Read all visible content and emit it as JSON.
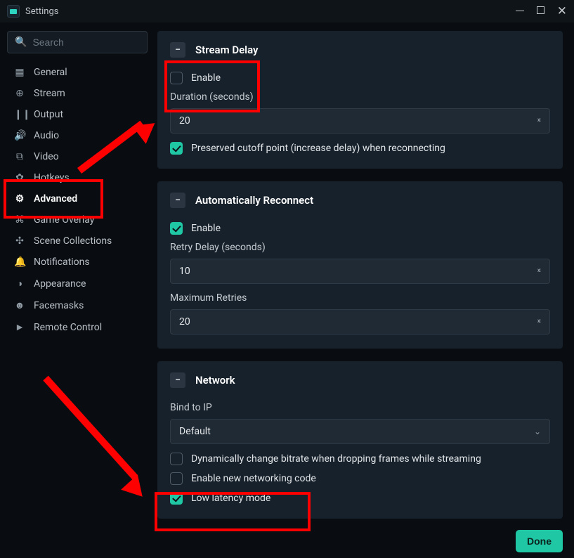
{
  "window": {
    "title": "Settings"
  },
  "search": {
    "placeholder": "Search"
  },
  "sidebar": {
    "items": [
      {
        "label": "General",
        "icon": "▦"
      },
      {
        "label": "Stream",
        "icon": "⊕"
      },
      {
        "label": "Output",
        "icon": "❙❙"
      },
      {
        "label": "Audio",
        "icon": "🔊"
      },
      {
        "label": "Video",
        "icon": "⧉"
      },
      {
        "label": "Hotkeys",
        "icon": "✿"
      },
      {
        "label": "Advanced",
        "icon": "⚙",
        "active": true
      },
      {
        "label": "Game Overlay",
        "icon": "⌘"
      },
      {
        "label": "Scene Collections",
        "icon": "✣"
      },
      {
        "label": "Notifications",
        "icon": "🔔"
      },
      {
        "label": "Appearance",
        "icon": "◑"
      },
      {
        "label": "Facemasks",
        "icon": "☻"
      },
      {
        "label": "Remote Control",
        "icon": "►"
      }
    ]
  },
  "sections": {
    "streamDelay": {
      "title": "Stream Delay",
      "enable_label": "Enable",
      "enable_checked": false,
      "duration_label": "Duration (seconds)",
      "duration_value": "20",
      "preserve_label": "Preserved cutoff point (increase delay) when reconnecting",
      "preserve_checked": true
    },
    "autoReconnect": {
      "title": "Automatically Reconnect",
      "enable_label": "Enable",
      "enable_checked": true,
      "retry_label": "Retry Delay (seconds)",
      "retry_value": "10",
      "max_label": "Maximum Retries",
      "max_value": "20"
    },
    "network": {
      "title": "Network",
      "bind_label": "Bind to IP",
      "bind_value": "Default",
      "dyn_label": "Dynamically change bitrate when dropping frames while streaming",
      "dyn_checked": false,
      "newnet_label": "Enable new networking code",
      "newnet_checked": false,
      "lowlat_label": "Low latency mode",
      "lowlat_checked": true
    }
  },
  "footer": {
    "done_label": "Done"
  }
}
